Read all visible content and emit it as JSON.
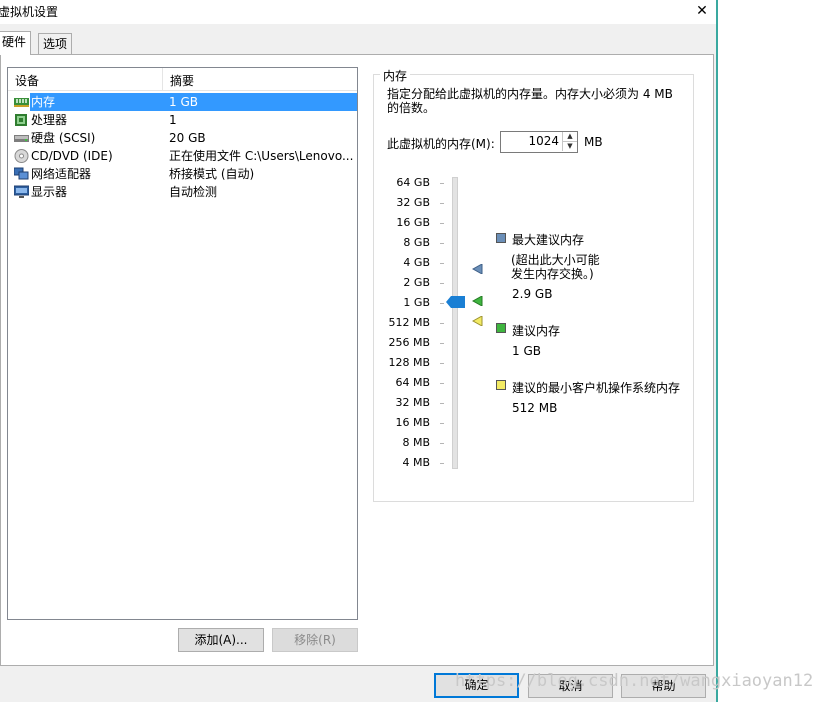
{
  "window": {
    "title": "虚拟机设置",
    "close_glyph": "✕"
  },
  "tabs": [
    {
      "label": "硬件",
      "active": true
    },
    {
      "label": "选项",
      "active": false
    }
  ],
  "device_list": {
    "columns": [
      "设备",
      "摘要"
    ],
    "rows": [
      {
        "name": "内存",
        "summary": "1 GB",
        "icon": "memory-icon",
        "selected": true
      },
      {
        "name": "处理器",
        "summary": "1",
        "icon": "processor-icon",
        "selected": false
      },
      {
        "name": "硬盘 (SCSI)",
        "summary": "20 GB",
        "icon": "hard-disk-icon",
        "selected": false
      },
      {
        "name": "CD/DVD (IDE)",
        "summary": "正在使用文件 C:\\Users\\Lenovo...",
        "icon": "cd-dvd-icon",
        "selected": false
      },
      {
        "name": "网络适配器",
        "summary": "桥接模式 (自动)",
        "icon": "network-adapter-icon",
        "selected": false
      },
      {
        "name": "显示器",
        "summary": "自动检测",
        "icon": "display-icon",
        "selected": false
      }
    ]
  },
  "list_buttons": {
    "add": "添加(A)...",
    "remove": "移除(R)"
  },
  "memory_panel": {
    "group_title": "内存",
    "description": "指定分配给此虚拟机的内存量。内存大小必须为 4 MB 的倍数。",
    "input_label": "此虚拟机的内存(M):",
    "value": "1024",
    "unit": "MB",
    "scale": [
      "64 GB",
      "32 GB",
      "16 GB",
      "8 GB",
      "4 GB",
      "2 GB",
      "1 GB",
      "512 MB",
      "256 MB",
      "128 MB",
      "64 MB",
      "32 MB",
      "16 MB",
      "8 MB",
      "4 MB"
    ],
    "legend": {
      "max_title": "最大建议内存",
      "max_note_line1": "(超出此大小可能",
      "max_note_line2": "发生内存交换。)",
      "max_value": "2.9 GB",
      "rec_title": "建议内存",
      "rec_value": "1 GB",
      "min_title": "建议的最小客户机操作系统内存",
      "min_value": "512 MB"
    },
    "colors": {
      "max": "#6b8fb8",
      "recommended": "#3fb53f",
      "minimum": "#f2ea63",
      "slider_thumb": "#1a7fd4"
    }
  },
  "dialog_buttons": {
    "ok": "确定",
    "cancel": "取消",
    "help": "帮助"
  },
  "watermark": "https://blog.csdn.net/wangxiaoyan12"
}
